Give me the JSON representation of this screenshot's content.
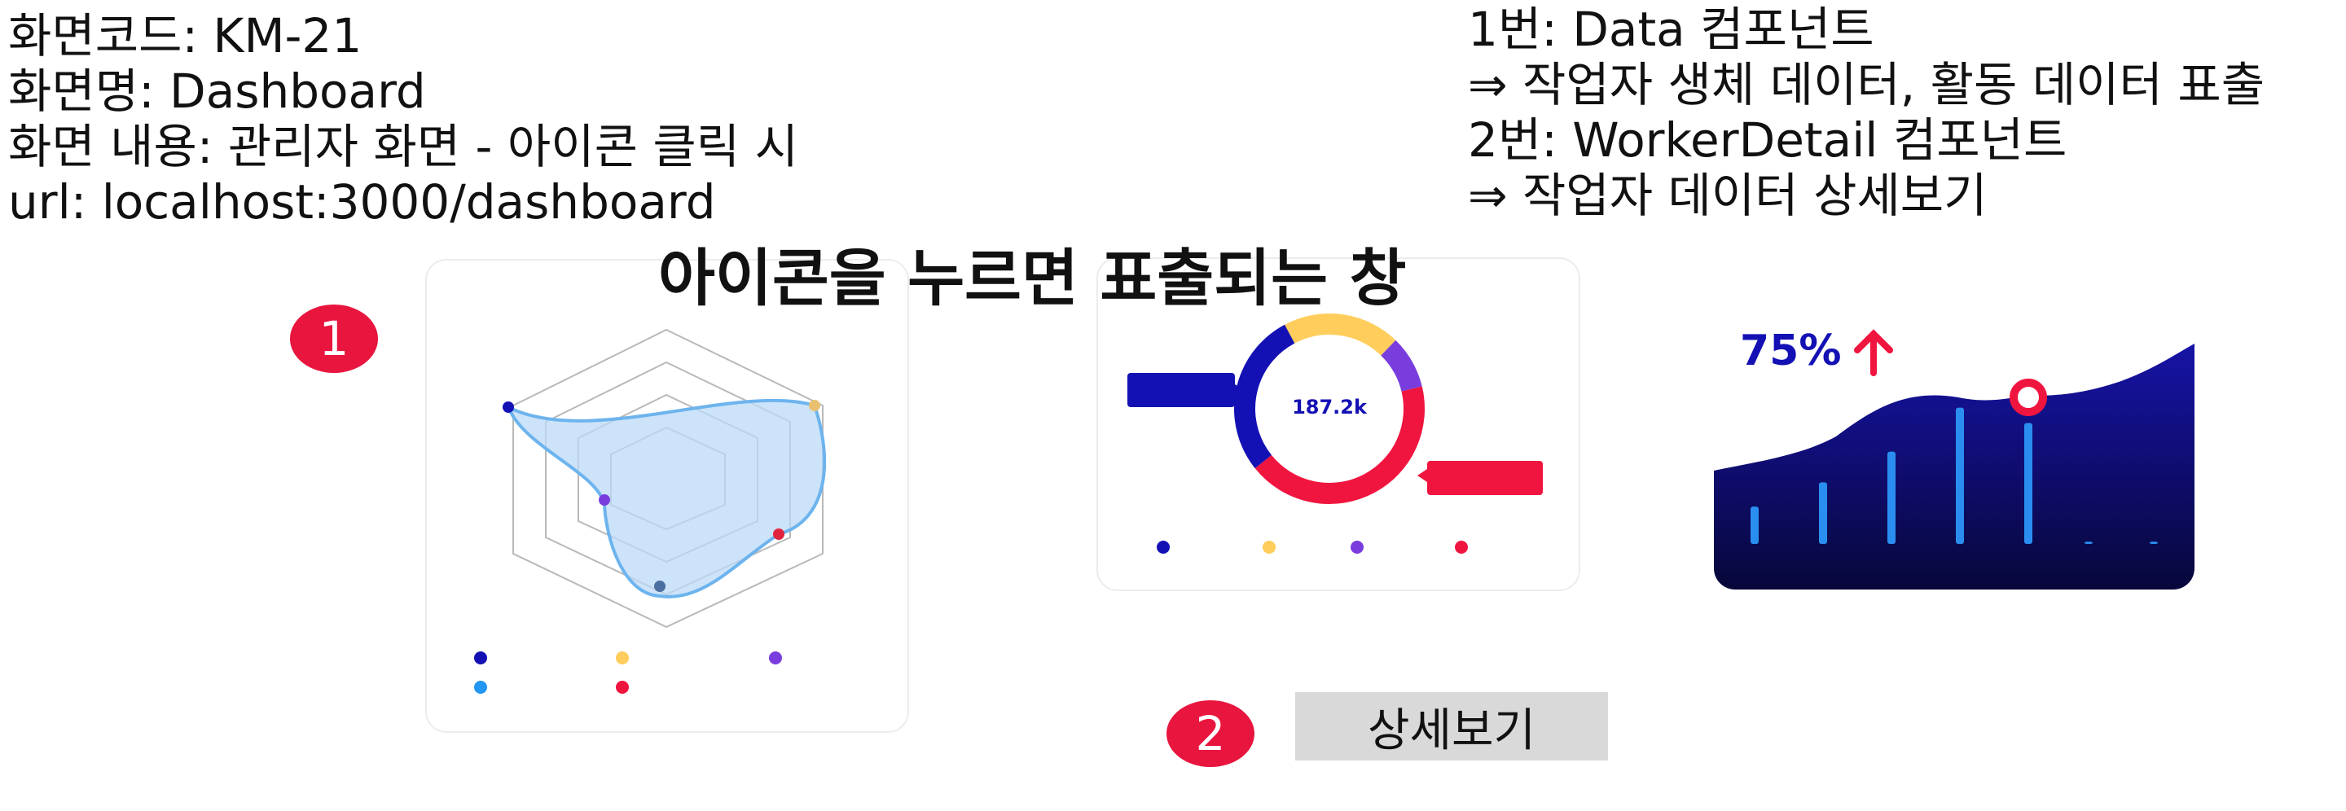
{
  "spec": {
    "left_lines": [
      "화면코드: KM-21",
      "화면명: Dashboard",
      "화면 내용: 관리자 화면 - 아이콘 클릭 시",
      "url: localhost:3000/dashboard"
    ],
    "right_lines": [
      "1번: Data 컴포넌트",
      "⇒ 작업자 생체 데이터, 활동 데이터 표출",
      "2번: WorkerDetail 컴포넌트",
      "⇒ 작업자 데이터 상세보기"
    ]
  },
  "popup_title": "아이콘을 누르면 표출되는 창",
  "badges": {
    "one": "1",
    "two": "2"
  },
  "detail_button_label": "상세보기",
  "donut": {
    "center_label": "187.2k",
    "segments": [
      {
        "color": "#ffcd5c",
        "fraction": 0.2
      },
      {
        "color": "#7a3ddd",
        "fraction": 0.09
      },
      {
        "color": "#f0153f",
        "fraction": 0.43
      },
      {
        "color": "#1411b4",
        "fraction": 0.28
      }
    ],
    "legend_dot_colors": [
      "#1411b4",
      "#ffcd5c",
      "#7a3ddd",
      "#f0153f"
    ]
  },
  "radar": {
    "legend_dot_colors": [
      "#1411b4",
      "#ffcd5c",
      "#7a3ddd",
      "#2196f3",
      "#f0153f"
    ],
    "point_colors": [
      "#1411b4",
      "#e8c070",
      "#e0233f",
      "#4a6fa0",
      "#7a3ddd"
    ]
  },
  "area_card": {
    "value_text": "75%",
    "arrow": "up-arrow-icon",
    "value_color": "#1411b4",
    "arrow_color": "#f0153f",
    "bar_levels": [
      0.17,
      0.28,
      0.42,
      0.62,
      0.55,
      0.01,
      0.01
    ]
  },
  "colors": {
    "badge": "#e8153e",
    "button_bg": "#d9d9d9"
  }
}
